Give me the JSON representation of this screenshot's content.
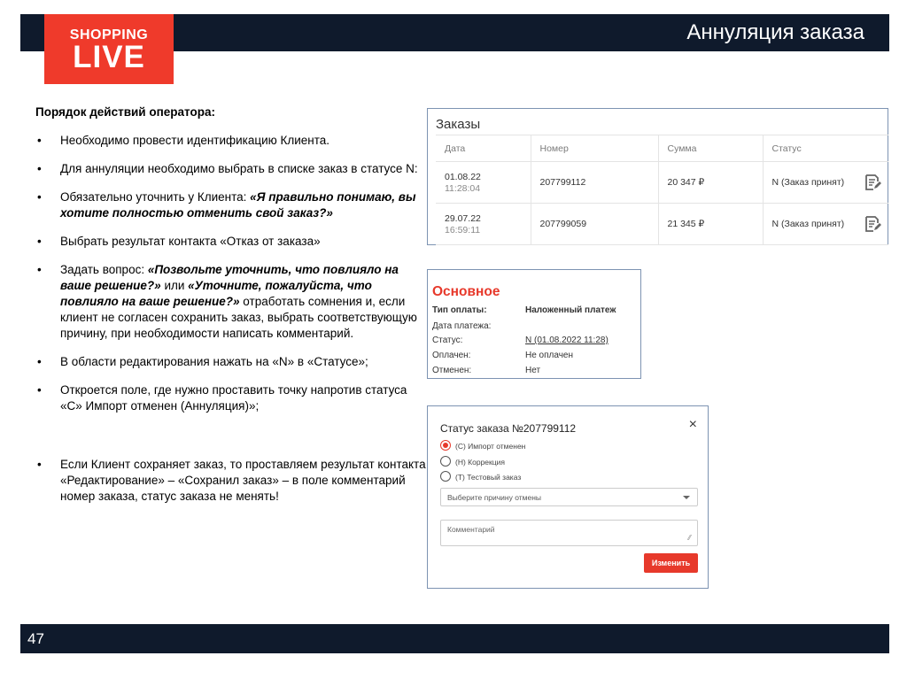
{
  "header": {
    "title": "Аннуляция заказа",
    "logo": {
      "line1": "SHOPPING",
      "line2": "LIVE"
    }
  },
  "footer": {
    "page_number": "47"
  },
  "instructions": {
    "heading": "Порядок действий оператора:",
    "b1": "Необходимо провести идентификацию Клиента.",
    "b2": "Для аннуляции необходимо выбрать в списке заказ в статусе N:",
    "b3_plain": "Обязательно уточнить у Клиента: ",
    "b3_bold": "«Я правильно понимаю, вы хотите полностью отменить свой заказ?»",
    "b4": "Выбрать результат контакта «Отказ от заказа»",
    "b5_p1": "Задать вопрос: ",
    "b5_b1": "«Позвольте уточнить, что повлияло на ваше решение?»",
    "b5_p2": " или ",
    "b5_b2": "«Уточните, пожалуйста, что повлияло на ваше решение?»",
    "b5_p3": " отработать сомнения и, если клиент не согласен сохранить заказ, выбрать соответствующую причину, при необходимости написать комментарий.",
    "b6": "В области редактирования нажать на «N» в «Статусе»;",
    "b7": "Откроется поле, где нужно проставить точку напротив статуса «С» Импорт отменен (Аннуляция)»;",
    "b8": "Если Клиент сохраняет заказ, то проставляем результат контакта «Редактирование» – «Сохранил заказ» – в поле комментарий номер заказа, статус заказа не менять!"
  },
  "orders": {
    "title": "Заказы",
    "columns": [
      "Дата",
      "Номер",
      "Сумма",
      "Статус"
    ],
    "rows": [
      {
        "date": "01.08.22",
        "time": "11:28:04",
        "number": "207799112",
        "sum": "20 347 ₽",
        "status": "N (Заказ принят)"
      },
      {
        "date": "29.07.22",
        "time": "16:59:11",
        "number": "207799059",
        "sum": "21 345 ₽",
        "status": "N (Заказ принят)"
      }
    ]
  },
  "main_info": {
    "title": "Основное",
    "rows": [
      {
        "key": "Тип оплаты:",
        "value": "Наложенный платеж"
      },
      {
        "key": "Дата платежа:",
        "value": ""
      },
      {
        "key": "Статус:",
        "value": "N (01.08.2022 11:28)"
      },
      {
        "key": "Оплачен:",
        "value": "Не оплачен"
      },
      {
        "key": "Отменен:",
        "value": "Нет"
      }
    ]
  },
  "status_dialog": {
    "title": "Статус заказа №207799112",
    "close": "×",
    "options": [
      "(С) Импорт отменен",
      "(Н) Коррекция",
      "(Т) Тестовый заказ"
    ],
    "selected_index": 0,
    "reason_placeholder": "Выберите причину отмены",
    "comment_placeholder": "Комментарий",
    "submit_label": "Изменить"
  },
  "colors": {
    "accent": "#e7392b",
    "band": "#0f1a2c"
  }
}
